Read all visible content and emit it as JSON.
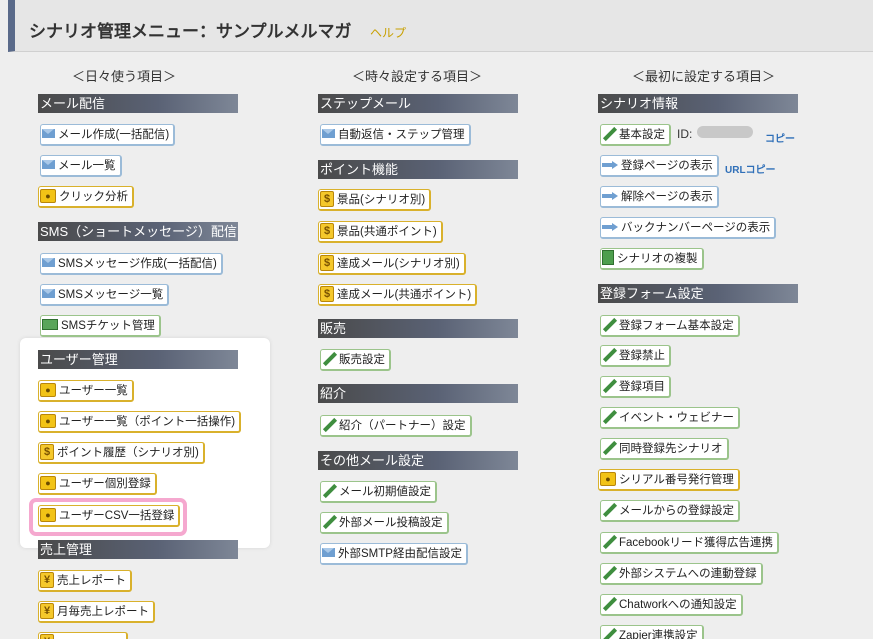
{
  "header": {
    "title": "シナリオ管理メニュー：サンプルメルマガ",
    "help": "ヘルプ"
  },
  "columns": {
    "daily": "＜日々使う項目＞",
    "occasional": "＜時々設定する項目＞",
    "initial": "＜最初に設定する項目＞"
  },
  "sections": {
    "mail_delivery": "メール配信",
    "sms_delivery": "SMS（ショートメッセージ）配信",
    "user_management": "ユーザー管理",
    "sales_management": "売上管理",
    "step_mail": "ステップメール",
    "point": "ポイント機能",
    "sales": "販売",
    "referral": "紹介",
    "other_mail": "その他メール設定",
    "scenario_info": "シナリオ情報",
    "form_settings": "登録フォーム設定"
  },
  "buttons": {
    "mail_create": "メール作成(一括配信)",
    "mail_list": "メール一覧",
    "click_analysis": "クリック分析",
    "sms_create": "SMSメッセージ作成(一括配信)",
    "sms_list": "SMSメッセージ一覧",
    "sms_ticket": "SMSチケット管理",
    "user_list": "ユーザー一覧",
    "user_list_points": "ユーザー一覧（ポイント一括操作)",
    "point_history": "ポイント履歴（シナリオ別)",
    "user_register": "ユーザー個別登録",
    "user_csv": "ユーザーCSV一括登録",
    "sales_report": "売上レポート",
    "monthly_report": "月毎売上レポート",
    "autoreply_step": "自動返信・ステップ管理",
    "prize_scenario": "景品(シナリオ別)",
    "prize_common": "景品(共通ポイント)",
    "achievement_scenario": "達成メール(シナリオ別)",
    "achievement_common": "達成メール(共通ポイント)",
    "sales_settings": "販売設定",
    "referral_partner": "紹介（パートナー）設定",
    "mail_initial": "メール初期値設定",
    "external_post": "外部メール投稿設定",
    "external_smtp": "外部SMTP経由配信設定",
    "basic_settings": "基本設定",
    "show_register": "登録ページの表示",
    "show_cancel": "解除ページの表示",
    "show_backnumber": "バックナンバーページの表示",
    "duplicate_scenario": "シナリオの複製",
    "form_basic": "登録フォーム基本設定",
    "register_ban": "登録禁止",
    "register_fields": "登録項目",
    "event_webinar": "イベント・ウェビナー",
    "simultaneous": "同時登録先シナリオ",
    "serial_number": "シリアル番号発行管理",
    "from_mail": "メールからの登録設定",
    "facebook_ads": "Facebookリード獲得広告連携",
    "external_system": "外部システムへの連動登録",
    "chatwork": "Chatworkへの通知設定",
    "zapier": "Zapier連携設定"
  },
  "scenario_id": {
    "label": "ID:",
    "copy": "コピー",
    "url_copy": "URLコピー"
  }
}
